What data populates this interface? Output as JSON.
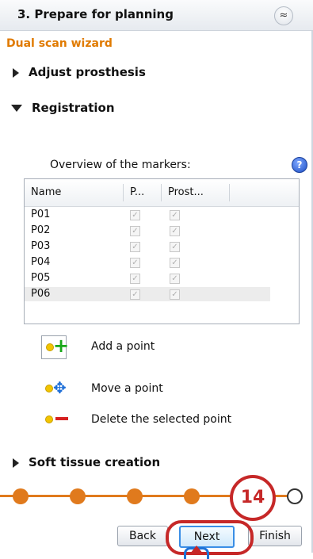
{
  "header": {
    "title": "3. Prepare for planning",
    "collapse_glyph": "≈"
  },
  "wizard_title": "Dual scan wizard",
  "sections": {
    "adjust": "Adjust prosthesis",
    "registration": "Registration",
    "soft_tissue": "Soft tissue creation"
  },
  "overview_label": "Overview of the markers:",
  "help_glyph": "?",
  "table": {
    "headers": [
      "Name",
      "P...",
      "Prost..."
    ],
    "rows": [
      {
        "name": "P01",
        "p": true,
        "prost": true
      },
      {
        "name": "P02",
        "p": true,
        "prost": true
      },
      {
        "name": "P03",
        "p": true,
        "prost": true
      },
      {
        "name": "P04",
        "p": true,
        "prost": true
      },
      {
        "name": "P05",
        "p": true,
        "prost": true
      },
      {
        "name": "P06",
        "p": true,
        "prost": true
      }
    ],
    "selected_row": "P06"
  },
  "tools": {
    "add": "Add a point",
    "move": "Move a point",
    "delete": "Delete the selected point"
  },
  "progress": {
    "total_steps": 6,
    "current_step": 5
  },
  "badge": "14",
  "buttons": {
    "back": "Back",
    "next": "Next",
    "finish": "Finish"
  },
  "colors": {
    "accent": "#e07a1d",
    "highlight": "#c62828",
    "link_blue": "#1e73d8"
  }
}
